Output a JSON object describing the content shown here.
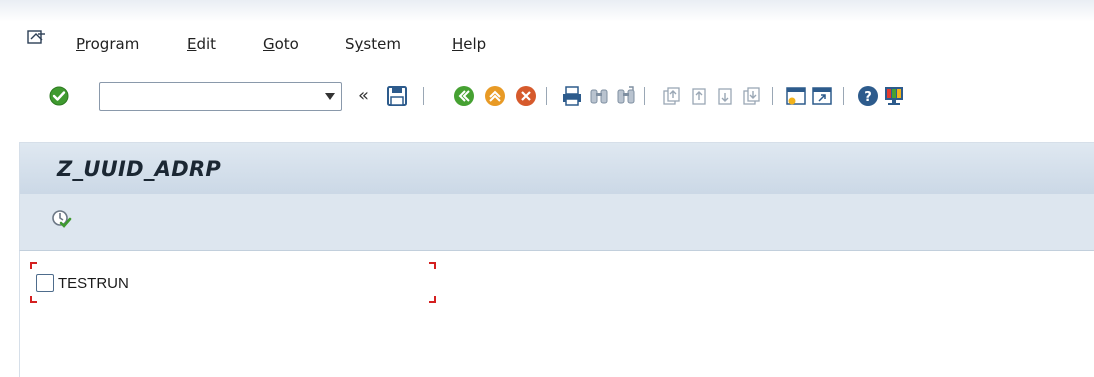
{
  "menu": {
    "items": [
      {
        "label": "Program",
        "accel": "P",
        "rest": "rogram"
      },
      {
        "label": "Edit",
        "accel": "E",
        "rest": "dit"
      },
      {
        "label": "Goto",
        "accel": "G",
        "rest": "oto"
      },
      {
        "label": "System",
        "accel": "y",
        "pre": "S",
        "rest": "stem"
      },
      {
        "label": "Help",
        "accel": "H",
        "rest": "elp"
      }
    ]
  },
  "toolbar": {
    "command_field_value": "",
    "icons": [
      "ok-icon",
      "back-icon",
      "save-icon",
      "back-green-icon",
      "exit-icon",
      "cancel-icon",
      "print-icon",
      "find-icon",
      "find-next-icon",
      "first-page-icon",
      "previous-page-icon",
      "next-page-icon",
      "last-page-icon",
      "create-session-icon",
      "shortcut-icon",
      "help-icon",
      "customize-layout-icon"
    ]
  },
  "screen": {
    "title": "Z_UUID_ADRP"
  },
  "selection": {
    "checkbox_label": "TESTRUN",
    "checked": false
  },
  "colors": {
    "title_bg": "#d6e0eb",
    "ok_green": "#3f9a2f",
    "exit_orange": "#e08a1e",
    "cancel_red": "#d5502a"
  }
}
